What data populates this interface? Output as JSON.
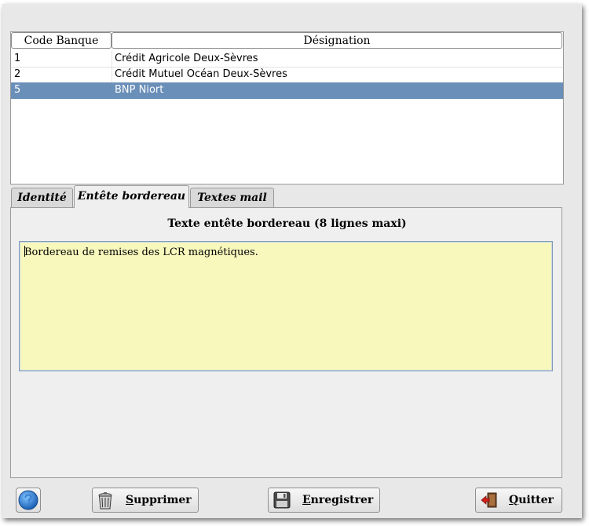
{
  "table": {
    "headers": [
      "Code Banque",
      "Désignation"
    ],
    "rows": [
      {
        "code": "1",
        "designation": "Crédit Agricole Deux-Sèvres"
      },
      {
        "code": "2",
        "designation": "Crédit Mutuel Océan Deux-Sèvres"
      },
      {
        "code": "5",
        "designation": "BNP Niort"
      }
    ],
    "selected_row": 2,
    "selection_color": "#6a8fb8"
  },
  "tabs": [
    {
      "label": "Identité",
      "active": false
    },
    {
      "label": "Entête bordereau",
      "active": true
    },
    {
      "label": "Textes mail",
      "active": false
    }
  ],
  "panel": {
    "title": "Texte entête bordereau (8 lignes maxi)",
    "textarea_value": "Bordereau de remises des LCR magnétiques.",
    "textarea_bg": "#f8f8bd"
  },
  "buttons": {
    "help_icon": "help-question-icon",
    "delete": {
      "first": "S",
      "rest": "upprimer",
      "icon": "trash-can-icon"
    },
    "save": {
      "first": "E",
      "rest": "nregistrer",
      "icon": "floppy-disk-icon"
    },
    "quit": {
      "first": "Q",
      "rest": "uitter",
      "icon": "exit-door-icon"
    }
  }
}
